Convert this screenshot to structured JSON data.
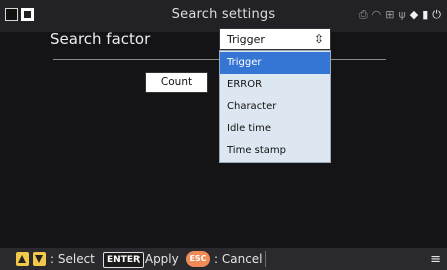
{
  "window": {
    "title": "Search settings"
  },
  "status_icons": [
    "print-icon",
    "wifi-icon",
    "network-icon",
    "usb-icon",
    "tag-icon",
    "sd-card-icon",
    "power-plug-icon"
  ],
  "search": {
    "label": "Search factor",
    "selected": "Trigger",
    "options": [
      "Trigger",
      "ERROR",
      "Character",
      "Idle time",
      "Time stamp"
    ]
  },
  "count_field": {
    "value": "Count"
  },
  "footer": {
    "select_label": ": Select",
    "enter_key": "ENTER",
    "apply_label": ": Apply",
    "esc_key": "ESC",
    "cancel_label": ": Cancel"
  },
  "colors": {
    "highlight": "#3575d3",
    "dropdown_bg": "#dce7f1",
    "arrow_keys": "#f1c84a",
    "esc_key": "#f08a56"
  }
}
